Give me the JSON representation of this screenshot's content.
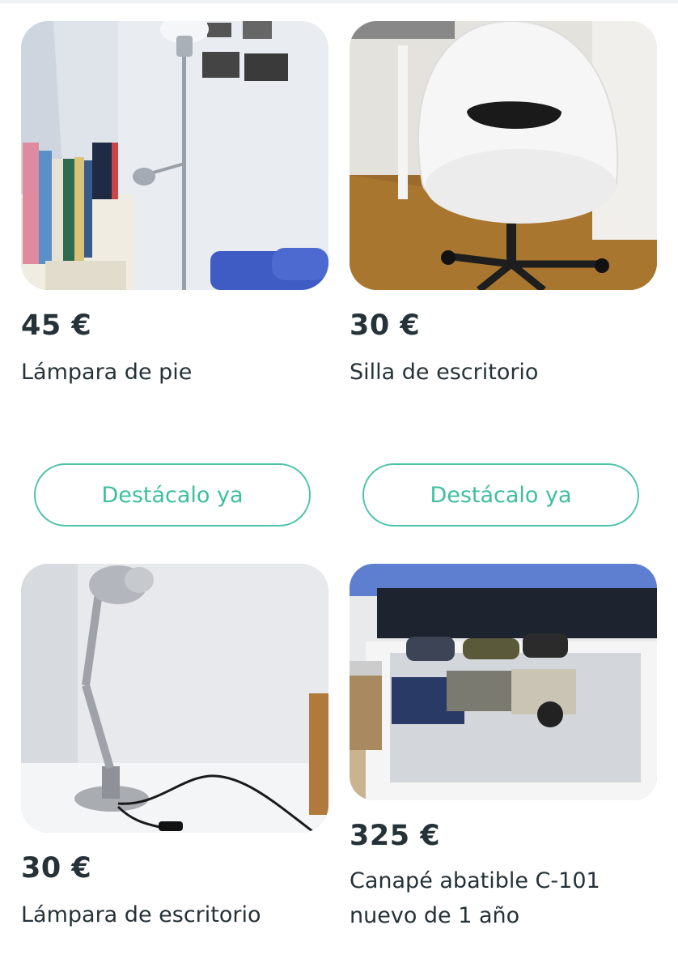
{
  "listings": [
    {
      "price": "45 €",
      "title": "Lámpara de pie",
      "cta": "Destácalo ya"
    },
    {
      "price": "30 €",
      "title": "Silla de escritorio",
      "cta": "Destácalo ya"
    },
    {
      "price": "30 €",
      "title": "Lámpara de escritorio"
    },
    {
      "price": "325 €",
      "title_line1": "Canapé abatible C-101",
      "title_line2": "nuevo de 1 año"
    }
  ],
  "colors": {
    "accent": "#4fc3a9",
    "text": "#253238"
  }
}
